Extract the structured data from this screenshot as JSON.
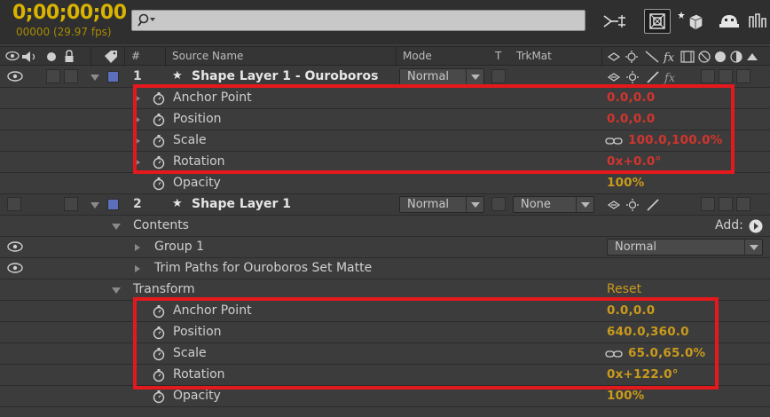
{
  "timecode": "0;00;00;00",
  "frame_info": "00000 (29.97 fps)",
  "search": {
    "placeholder": ""
  },
  "columns": {
    "hash": "#",
    "source_name": "Source Name",
    "mode": "Mode",
    "t": "T",
    "trkmat": "TrkMat",
    "fx": "fx"
  },
  "layer1": {
    "number": "1",
    "name": "Shape Layer 1 - Ouroboros",
    "mode": "Normal",
    "properties": [
      {
        "label": "Anchor Point",
        "value": "0.0,0.0"
      },
      {
        "label": "Position",
        "value": "0.0,0.0"
      },
      {
        "label": "Scale",
        "value": "100.0,100.0%"
      },
      {
        "label": "Rotation",
        "value": "0x+0.0°"
      },
      {
        "label": "Opacity",
        "value": "100%"
      }
    ]
  },
  "layer2": {
    "number": "2",
    "name": "Shape Layer 1",
    "mode": "Normal",
    "trkmat": "None",
    "contents_label": "Contents",
    "add_label": "Add:",
    "group_label": "Group 1",
    "group_mode": "Normal",
    "trim_label": "Trim Paths for Ouroboros Set Matte",
    "transform_label": "Transform",
    "reset_label": "Reset",
    "properties": [
      {
        "label": "Anchor Point",
        "value": "0.0,0.0"
      },
      {
        "label": "Position",
        "value": "640.0,360.0"
      },
      {
        "label": "Scale",
        "value": "65.0,65.0%"
      },
      {
        "label": "Rotation",
        "value": "0x+122.0°"
      },
      {
        "label": "Opacity",
        "value": "100%"
      }
    ]
  },
  "colors": {
    "timecode": "#d9b300",
    "value_red": "#d2352e",
    "value_orange": "#c99a1c",
    "highlight": "#e3191d",
    "label_swatch": "#5d6fb8"
  },
  "icons": [
    "search-icon",
    "graph-editor-icon",
    "composition-icon",
    "3d-draft-icon",
    "brainstorm-icon",
    "stopwatch-icon",
    "eye-icon",
    "audio-icon",
    "lock-icon",
    "label-icon",
    "star-icon",
    "chain-link-icon",
    "add-icon"
  ]
}
